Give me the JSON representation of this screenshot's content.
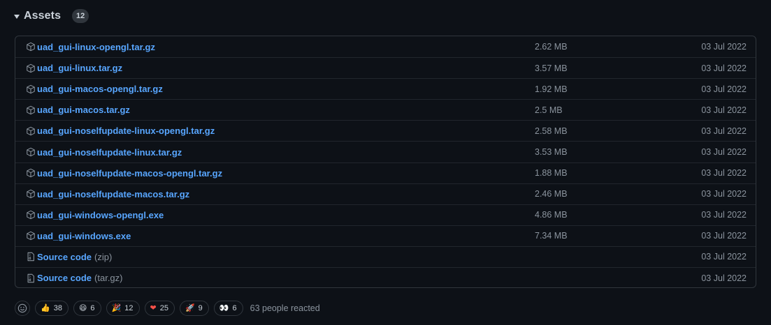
{
  "header": {
    "title": "Assets",
    "count": "12"
  },
  "assets": [
    {
      "name": "uad_gui-linux-opengl.tar.gz",
      "suffix": "",
      "size": "2.62 MB",
      "date": "03 Jul 2022",
      "icon": "package-icon"
    },
    {
      "name": "uad_gui-linux.tar.gz",
      "suffix": "",
      "size": "3.57 MB",
      "date": "03 Jul 2022",
      "icon": "package-icon"
    },
    {
      "name": "uad_gui-macos-opengl.tar.gz",
      "suffix": "",
      "size": "1.92 MB",
      "date": "03 Jul 2022",
      "icon": "package-icon"
    },
    {
      "name": "uad_gui-macos.tar.gz",
      "suffix": "",
      "size": "2.5 MB",
      "date": "03 Jul 2022",
      "icon": "package-icon"
    },
    {
      "name": "uad_gui-noselfupdate-linux-opengl.tar.gz",
      "suffix": "",
      "size": "2.58 MB",
      "date": "03 Jul 2022",
      "icon": "package-icon"
    },
    {
      "name": "uad_gui-noselfupdate-linux.tar.gz",
      "suffix": "",
      "size": "3.53 MB",
      "date": "03 Jul 2022",
      "icon": "package-icon"
    },
    {
      "name": "uad_gui-noselfupdate-macos-opengl.tar.gz",
      "suffix": "",
      "size": "1.88 MB",
      "date": "03 Jul 2022",
      "icon": "package-icon"
    },
    {
      "name": "uad_gui-noselfupdate-macos.tar.gz",
      "suffix": "",
      "size": "2.46 MB",
      "date": "03 Jul 2022",
      "icon": "package-icon"
    },
    {
      "name": "uad_gui-windows-opengl.exe",
      "suffix": "",
      "size": "4.86 MB",
      "date": "03 Jul 2022",
      "icon": "package-icon"
    },
    {
      "name": "uad_gui-windows.exe",
      "suffix": "",
      "size": "7.34 MB",
      "date": "03 Jul 2022",
      "icon": "package-icon"
    },
    {
      "name": "Source code",
      "suffix": "(zip)",
      "size": "",
      "date": "03 Jul 2022",
      "icon": "file-zip-icon"
    },
    {
      "name": "Source code",
      "suffix": "(tar.gz)",
      "size": "",
      "date": "03 Jul 2022",
      "icon": "file-zip-icon"
    }
  ],
  "reactions": {
    "add_icon": "smiley-icon",
    "items": [
      {
        "emoji": "👍",
        "name": "thumbs-up",
        "count": "38"
      },
      {
        "emoji": "😄",
        "name": "laugh",
        "count": "6"
      },
      {
        "emoji": "🎉",
        "name": "hooray",
        "count": "12"
      },
      {
        "emoji": "❤",
        "name": "heart",
        "count": "25"
      },
      {
        "emoji": "🚀",
        "name": "rocket",
        "count": "9"
      },
      {
        "emoji": "👀",
        "name": "eyes",
        "count": "6"
      }
    ],
    "summary": "63 people reacted"
  },
  "colors": {
    "background": "#0d1117",
    "link": "#58a6ff",
    "muted": "#8b949e",
    "border": "#30363d"
  }
}
